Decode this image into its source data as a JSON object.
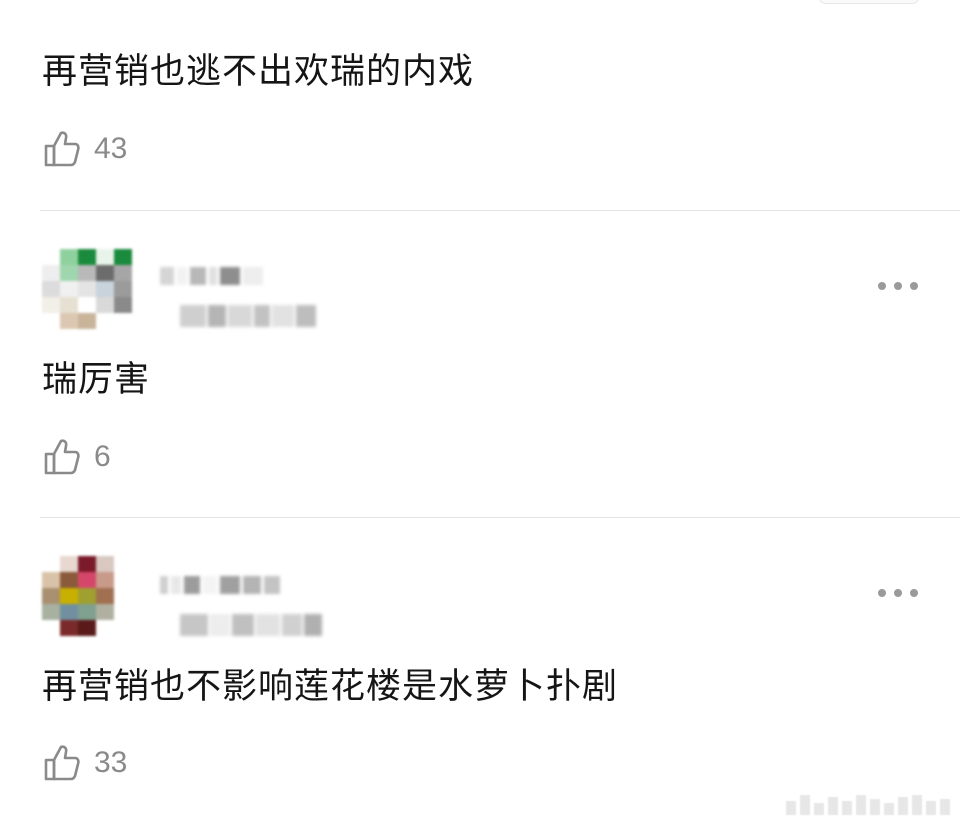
{
  "comments": [
    {
      "text": "再营销也逃不出欢瑞的内戏",
      "likes": "43",
      "has_header": false
    },
    {
      "text": "瑞厉害",
      "likes": "6",
      "has_header": true
    },
    {
      "text": "再营销也不影响莲花楼是水萝卜扑剧",
      "likes": "33",
      "has_header": true
    }
  ],
  "icons": {
    "like": "thumbs-up-icon",
    "more": "more-horizontal-icon"
  },
  "colors": {
    "text": "#151515",
    "meta": "#8a8a8a",
    "divider": "#e3e3e3"
  }
}
